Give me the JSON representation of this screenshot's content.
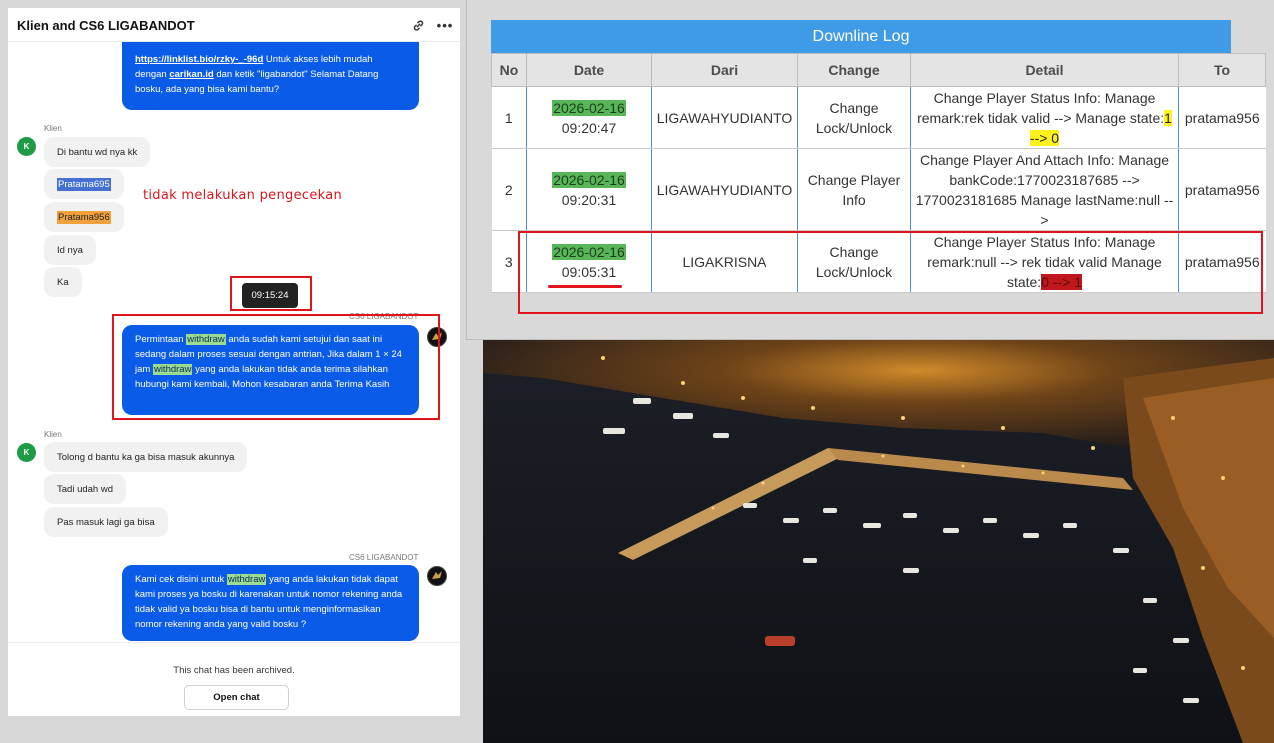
{
  "chat": {
    "title": "Klien and CS6 LIGABANDOT",
    "header_icons": [
      "link-icon",
      "more-icon"
    ],
    "messages": [
      {
        "from": "agent",
        "link1": "https://linklist.bio/rzky-_-96d",
        "text1": " Untuk akses lebih mudah dengan ",
        "link2": "carikan.id",
        "text2": " dan ketik \"ligabandot\" Selamat Datang bosku, ada yang bisa kami bantu?"
      }
    ],
    "klien_label_1": "Klien",
    "klien_avatar": "K",
    "in_group_1": [
      "Di bantu wd nya kk",
      "Pratama695",
      "Pratama956",
      "Id nya",
      "Ka"
    ],
    "annotation": "tidak melakukan pengecekan",
    "tooltip_time": "09:15:24",
    "agent_label_1": "CS6 LIGABANDOT",
    "agent_msg_2": {
      "p1": "Permintaan ",
      "hl1": "withdraw",
      "p2": " anda sudah kami setujui dan saat ini sedang dalam proses sesuai dengan antrian, Jika dalam 1 × 24 jam ",
      "hl2": "withdraw",
      "p3": " yang anda lakukan tidak anda terima silahkan hubungi kami kembali, Mohon kesabaran anda Terima Kasih"
    },
    "klien_label_2": "Klien",
    "in_group_2": [
      "Tolong d bantu ka ga bisa masuk akunnya",
      "Tadi udah wd",
      "Pas masuk lagi ga bisa"
    ],
    "agent_label_2": "CS6 LIGABANDOT",
    "agent_msg_3": {
      "p1": "Kami cek disini untuk ",
      "hl1": "withdraw",
      "p2": " yang anda lakukan tidak dapat kami proses ya bosku di karenakan untuk nomor rekening anda tidak valid ya bosku bisa di bantu untuk menginformasikan nomor rekening anda yang valid bosku ?"
    },
    "archived_text": "This chat has been archived.",
    "open_chat_label": "Open chat"
  },
  "log": {
    "title": "Downline Log",
    "columns": [
      "No",
      "Date",
      "Dari",
      "Change",
      "Detail",
      "To"
    ],
    "rows": [
      {
        "no": "1",
        "date": "2026-02-16",
        "time": "09:20:47",
        "dari": "LIGAWAHYUDIANTO",
        "change": "Change Lock/Unlock",
        "detail_main": "Change Player Status Info: Manage remark:rek tidak valid --> Manage state:",
        "detail_value": "1 --> 0",
        "to": "pratama956"
      },
      {
        "no": "2",
        "date": "2026-02-16",
        "time": "09:20:31",
        "dari": "LIGAWAHYUDIANTO",
        "change": "Change Player Info",
        "detail_main": "Change Player And Attach Info: Manage bankCode:1770023187685 --> 1770023181685 Manage lastName:null -->",
        "detail_value": "",
        "to": "pratama956"
      },
      {
        "no": "3",
        "date": "2026-02-16",
        "time": "09:05:31",
        "dari": "LIGAKRISNA",
        "change": "Change Lock/Unlock",
        "detail_main": "Change Player Status Info: Manage remark:null --> rek tidak valid Manage state:",
        "detail_value": "0 --> 1",
        "to": "pratama956"
      }
    ]
  },
  "colors": {
    "agent_bubble": "#0a5ce8",
    "log_header": "#3f9be6",
    "annotation_red": "#e0141a",
    "date_highlight": "#59b55a",
    "value_yellow": "#fff21c",
    "value_red": "#c0171c"
  }
}
